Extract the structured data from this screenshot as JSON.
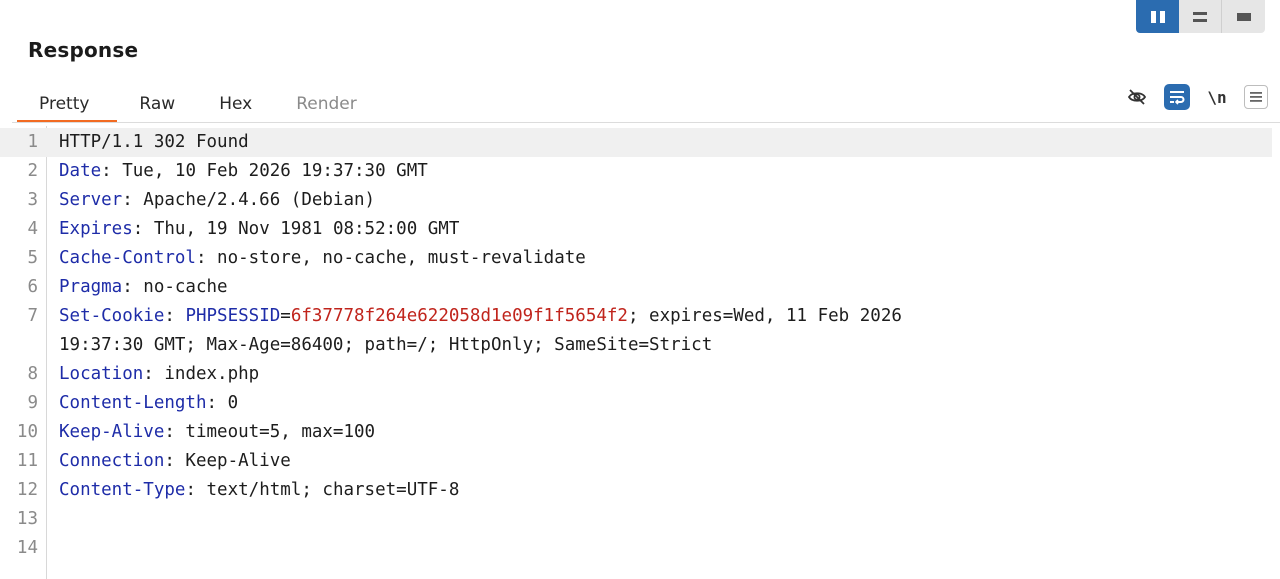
{
  "layout_toggle": {
    "options": [
      {
        "name": "split-horizontal",
        "active": true
      },
      {
        "name": "split-vertical",
        "active": false
      },
      {
        "name": "single-pane",
        "active": false
      }
    ]
  },
  "panel": {
    "title": "Response"
  },
  "tabs": [
    {
      "label": "Pretty",
      "active": true,
      "disabled": false
    },
    {
      "label": "Raw",
      "active": false,
      "disabled": false
    },
    {
      "label": "Hex",
      "active": false,
      "disabled": false
    },
    {
      "label": "Render",
      "active": false,
      "disabled": true
    }
  ],
  "toolbar": {
    "hide_icon": "eye-slash-icon",
    "wrap_icon": "wrap-lines-icon",
    "wrap_active": true,
    "newline_label": "\\n",
    "menu_icon": "hamburger-menu-icon"
  },
  "colors": {
    "accent_blue": "#2b6cb0",
    "tab_underline": "#f26b22",
    "header_name": "#1e2ca8",
    "cookie_value": "#c0241c"
  },
  "lines": [
    {
      "n": "1",
      "parts": [
        {
          "t": "HTTP/1.1 302 Found",
          "c": "pl"
        }
      ]
    },
    {
      "n": "2",
      "parts": [
        {
          "t": "Date",
          "c": "hn"
        },
        {
          "t": ": Tue, 10 Feb 2026 19:37:30 GMT",
          "c": "pl"
        }
      ]
    },
    {
      "n": "3",
      "parts": [
        {
          "t": "Server",
          "c": "hn"
        },
        {
          "t": ": Apache/2.4.66 (Debian)",
          "c": "pl"
        }
      ]
    },
    {
      "n": "4",
      "parts": [
        {
          "t": "Expires",
          "c": "hn"
        },
        {
          "t": ": Thu, 19 Nov 1981 08:52:00 GMT",
          "c": "pl"
        }
      ]
    },
    {
      "n": "5",
      "parts": [
        {
          "t": "Cache-Control",
          "c": "hn"
        },
        {
          "t": ": no-store, no-cache, must-revalidate",
          "c": "pl"
        }
      ]
    },
    {
      "n": "6",
      "parts": [
        {
          "t": "Pragma",
          "c": "hn"
        },
        {
          "t": ": no-cache",
          "c": "pl"
        }
      ]
    },
    {
      "n": "7",
      "parts": [
        {
          "t": "Set-Cookie",
          "c": "hn"
        },
        {
          "t": ": ",
          "c": "pl"
        },
        {
          "t": "PHPSESSID",
          "c": "ck"
        },
        {
          "t": "=",
          "c": "pl"
        },
        {
          "t": "6f37778f264e622058d1e09f1f5654f2",
          "c": "cv"
        },
        {
          "t": "; expires=Wed, 11 Feb 2026",
          "c": "pl"
        }
      ]
    },
    {
      "n": "",
      "parts": [
        {
          "t": "19:37:30 GMT; Max-Age=86400; path=/; HttpOnly; SameSite=Strict",
          "c": "pl"
        }
      ]
    },
    {
      "n": "8",
      "parts": [
        {
          "t": "Location",
          "c": "hn"
        },
        {
          "t": ": index.php",
          "c": "pl"
        }
      ]
    },
    {
      "n": "9",
      "parts": [
        {
          "t": "Content-Length",
          "c": "hn"
        },
        {
          "t": ": 0",
          "c": "pl"
        }
      ]
    },
    {
      "n": "10",
      "parts": [
        {
          "t": "Keep-Alive",
          "c": "hn"
        },
        {
          "t": ": timeout=5, max=100",
          "c": "pl"
        }
      ]
    },
    {
      "n": "11",
      "parts": [
        {
          "t": "Connection",
          "c": "hn"
        },
        {
          "t": ": Keep-Alive",
          "c": "pl"
        }
      ]
    },
    {
      "n": "12",
      "parts": [
        {
          "t": "Content-Type",
          "c": "hn"
        },
        {
          "t": ": text/html; charset=UTF-8",
          "c": "pl"
        }
      ]
    },
    {
      "n": "13",
      "parts": []
    },
    {
      "n": "14",
      "parts": []
    }
  ]
}
